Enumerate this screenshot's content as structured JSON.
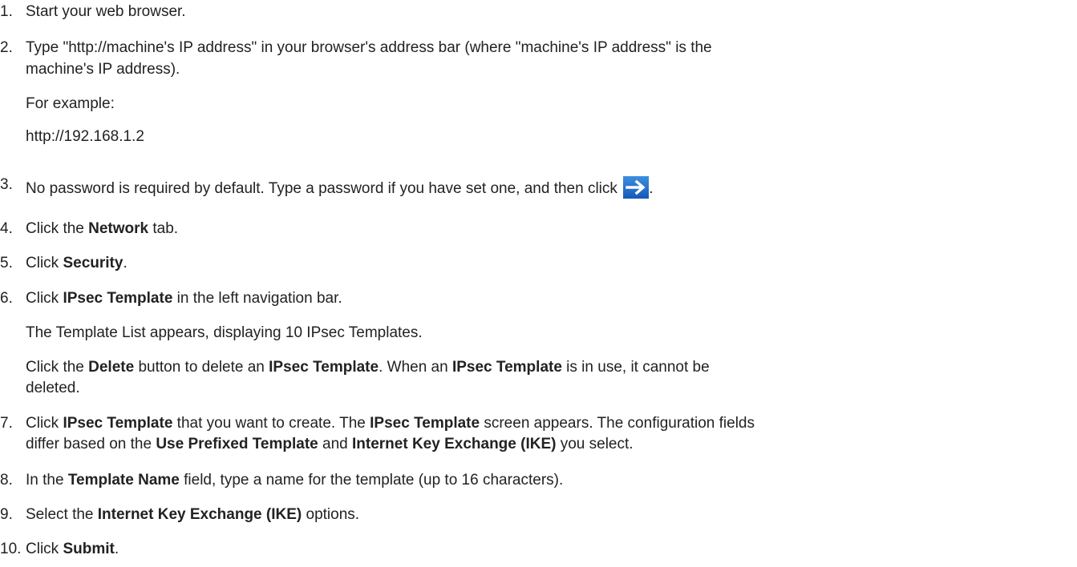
{
  "steps": [
    {
      "num": "1.",
      "text": "Start your web browser."
    },
    {
      "num": "2.",
      "text_a": "Type \"http://machine's IP address\" in your browser's address bar (where \"machine's IP address\" is the",
      "text_b": "machine's IP address).",
      "example_label": "For example:",
      "example_value": "http://192.168.1.2"
    },
    {
      "num": "3.",
      "text": "No password is required by default. Type a password if you have set one, and then click",
      "after_icon": ".",
      "icon": "go-arrow-icon"
    },
    {
      "num": "4.",
      "pre": "Click the ",
      "bold": "Network",
      "post": " tab."
    },
    {
      "num": "5.",
      "pre": "Click ",
      "bold": "Security",
      "post": "."
    },
    {
      "num": "6.",
      "pre": "Click ",
      "bold": "IPsec Template",
      "post": " in the left navigation bar.",
      "note1": "The Template List appears, displaying 10 IPsec Templates.",
      "note2_pre": "Click the ",
      "note2_b1": "Delete",
      "note2_mid1": " button to delete an ",
      "note2_b2": "IPsec Template",
      "note2_mid2": ". When an ",
      "note2_b3": "IPsec Template",
      "note2_post": " is in use, it cannot be",
      "note2_cont": "deleted."
    },
    {
      "num": "7.",
      "pre": "Click ",
      "b1": "IPsec Template",
      "mid1": " that you want to create. The ",
      "b2": "IPsec Template",
      "mid2": " screen appears. The configuration fields",
      "cont_pre": "differ based on the ",
      "cont_b1": "Use Prefixed Template",
      "cont_mid": " and ",
      "cont_b2": "Internet Key Exchange (IKE)",
      "cont_post": " you select."
    },
    {
      "num": "8.",
      "pre": "In the ",
      "bold": "Template Name",
      "post": " field, type a name for the template (up to 16 characters)."
    },
    {
      "num": "9.",
      "pre": "Select the ",
      "bold": "Internet Key Exchange (IKE)",
      "post": " options."
    },
    {
      "num": "10.",
      "pre": "Click ",
      "bold": "Submit",
      "post": "."
    }
  ]
}
